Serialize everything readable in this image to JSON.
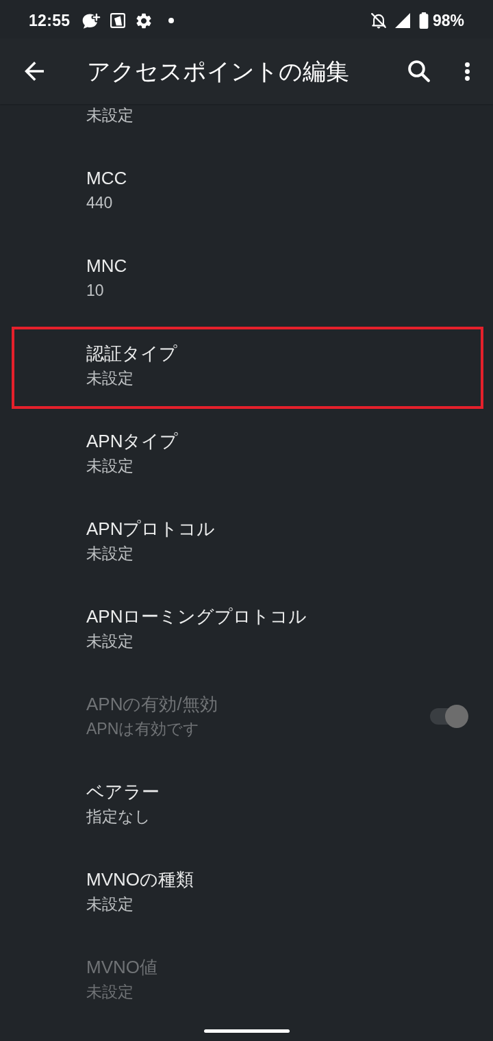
{
  "status_bar": {
    "time": "12:55",
    "battery": "98%"
  },
  "app_bar": {
    "title": "アクセスポイントの編集"
  },
  "items": [
    {
      "kind": "text",
      "summary": "未設定",
      "disabled": false,
      "highlighted": false
    },
    {
      "kind": "text",
      "title": "MCC",
      "summary": "440",
      "disabled": false,
      "highlighted": false
    },
    {
      "kind": "text",
      "title": "MNC",
      "summary": "10",
      "disabled": false,
      "highlighted": false
    },
    {
      "kind": "text",
      "title": "認証タイプ",
      "summary": "未設定",
      "disabled": false,
      "highlighted": true
    },
    {
      "kind": "text",
      "title": "APNタイプ",
      "summary": "未設定",
      "disabled": false,
      "highlighted": false
    },
    {
      "kind": "text",
      "title": "APNプロトコル",
      "summary": "未設定",
      "disabled": false,
      "highlighted": false
    },
    {
      "kind": "text",
      "title": "APNローミングプロトコル",
      "summary": "未設定",
      "disabled": false,
      "highlighted": false
    },
    {
      "kind": "switch",
      "title": "APNの有効/無効",
      "summary": "APNは有効です",
      "on": true,
      "disabled": true,
      "highlighted": false
    },
    {
      "kind": "text",
      "title": "ベアラー",
      "summary": "指定なし",
      "disabled": false,
      "highlighted": false
    },
    {
      "kind": "text",
      "title": "MVNOの種類",
      "summary": "未設定",
      "disabled": false,
      "highlighted": false
    },
    {
      "kind": "text",
      "title": "MVNO値",
      "summary": "未設定",
      "disabled": true,
      "highlighted": false
    }
  ]
}
